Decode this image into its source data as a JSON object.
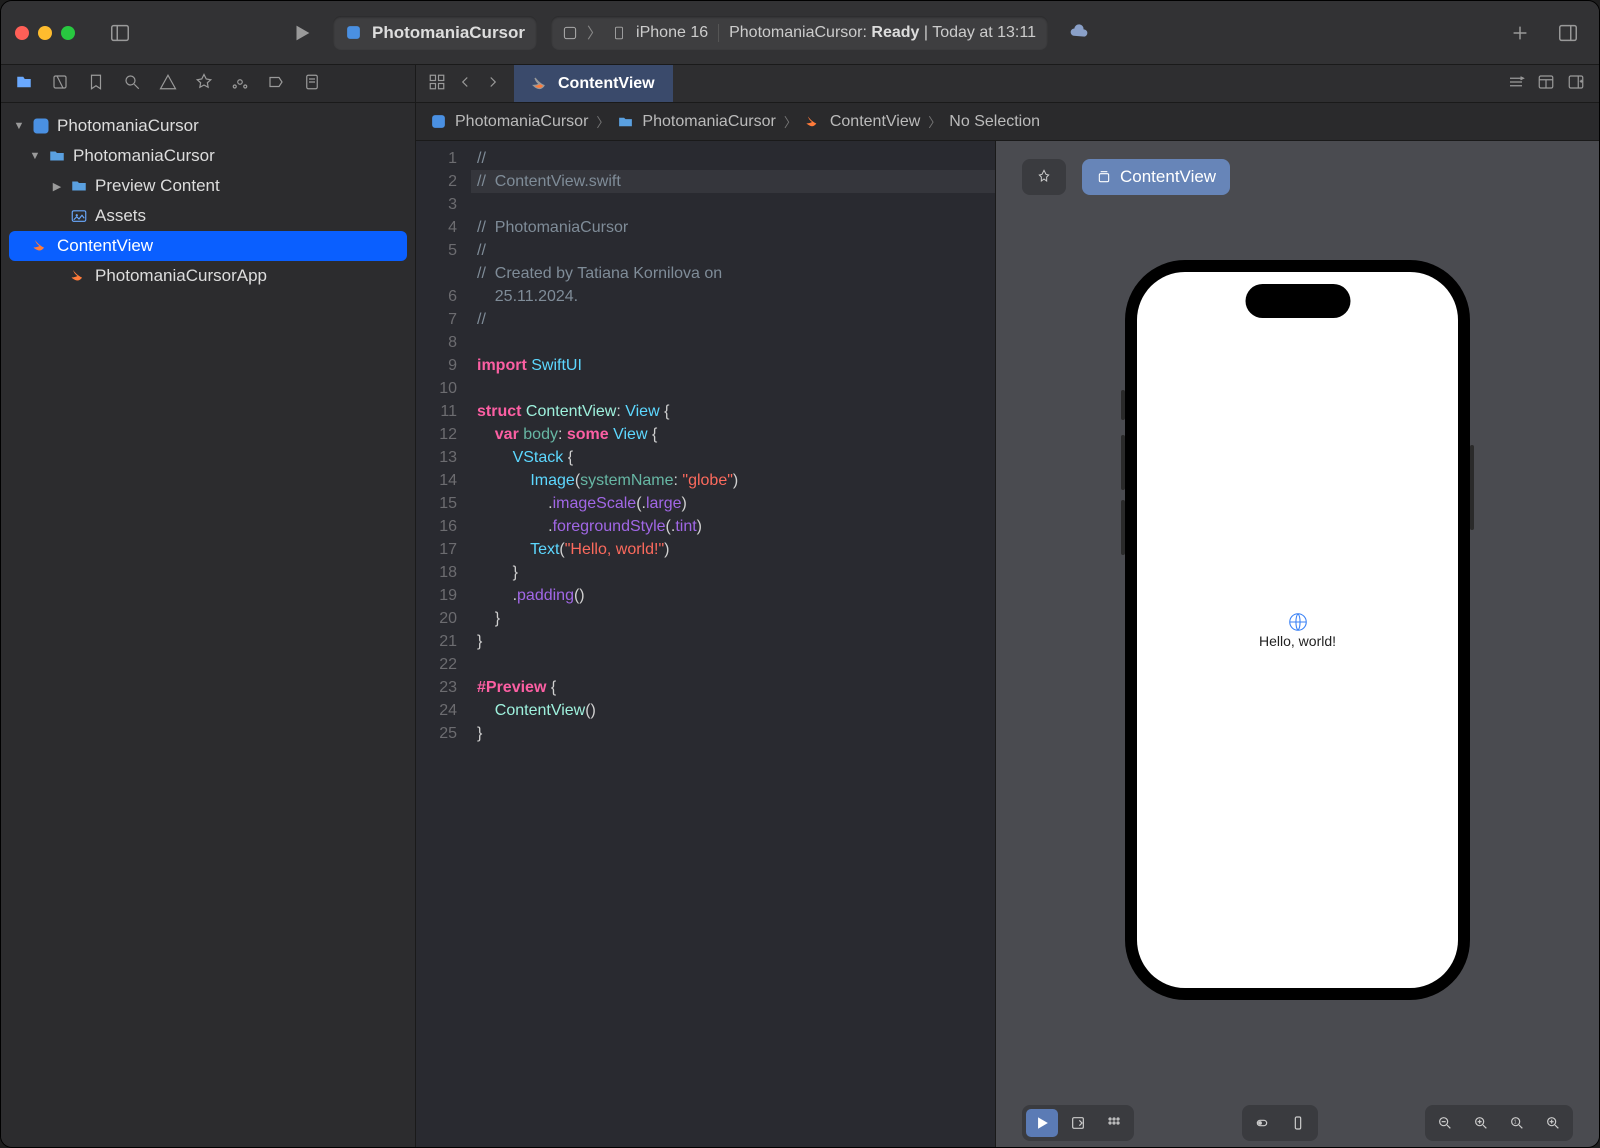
{
  "toolbar": {
    "project_name": "PhotomaniaCursor",
    "scheme": "PhotomaniaCursor",
    "device": "iPhone 16",
    "status_prefix": "PhotomaniaCursor:",
    "status_state": "Ready",
    "status_time": "Today at 13:11"
  },
  "navigator": {
    "root": "PhotomaniaCursor",
    "items": [
      {
        "label": "PhotomaniaCursor",
        "kind": "folder",
        "indent": 1,
        "open": true
      },
      {
        "label": "Preview Content",
        "kind": "folder",
        "indent": 2,
        "open": false
      },
      {
        "label": "Assets",
        "kind": "assets",
        "indent": 2
      },
      {
        "label": "ContentView",
        "kind": "swift",
        "indent": 2,
        "selected": true
      },
      {
        "label": "PhotomaniaCursorApp",
        "kind": "swift",
        "indent": 2
      }
    ]
  },
  "tab": {
    "label": "ContentView"
  },
  "jumpbar": {
    "segments": [
      "PhotomaniaCursor",
      "PhotomaniaCursor",
      "ContentView",
      "No Selection"
    ]
  },
  "code": {
    "lines": [
      "//",
      "//  ContentView.swift",
      "//  PhotomaniaCursor",
      "//",
      "//  Created by Tatiana Kornilova on 25.11.2024.",
      "//",
      "",
      "import SwiftUI",
      "",
      "struct ContentView: View {",
      "    var body: some View {",
      "        VStack {",
      "            Image(systemName: \"globe\")",
      "                .imageScale(.large)",
      "                .foregroundStyle(.tint)",
      "            Text(\"Hello, world!\")",
      "        }",
      "        .padding()",
      "    }",
      "}",
      "",
      "#Preview {",
      "    ContentView()",
      "}",
      ""
    ],
    "line_count": 25
  },
  "canvas": {
    "chip_label": "ContentView",
    "preview_text": "Hello, world!"
  }
}
